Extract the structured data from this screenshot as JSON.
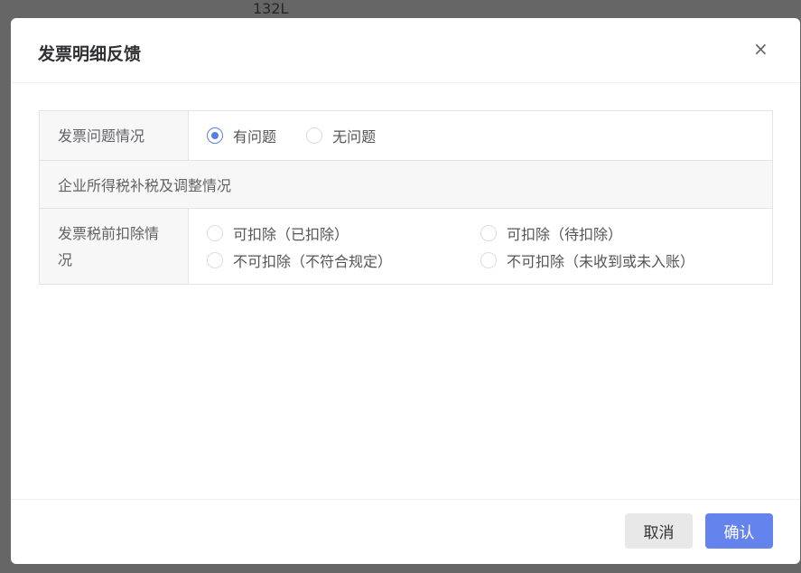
{
  "background": {
    "cell_text": "132L"
  },
  "dialog": {
    "title": "发票明细反馈",
    "close_icon": "×",
    "rows": {
      "issue": {
        "label": "发票问题情况",
        "options": [
          {
            "label": "有问题",
            "selected": true
          },
          {
            "label": "无问题",
            "selected": false
          }
        ]
      },
      "section": {
        "label": "企业所得税补税及调整情况"
      },
      "deduction": {
        "label": "发票税前扣除情况",
        "options": [
          {
            "label": "可扣除（已扣除）",
            "selected": false
          },
          {
            "label": "可扣除（待扣除）",
            "selected": false
          },
          {
            "label": "不可扣除（不符合规定）",
            "selected": false
          },
          {
            "label": "不可扣除（未收到或未入账）",
            "selected": false
          }
        ]
      }
    },
    "buttons": {
      "cancel": "取消",
      "confirm": "确认"
    }
  },
  "colors": {
    "accent": "#6583ec"
  }
}
